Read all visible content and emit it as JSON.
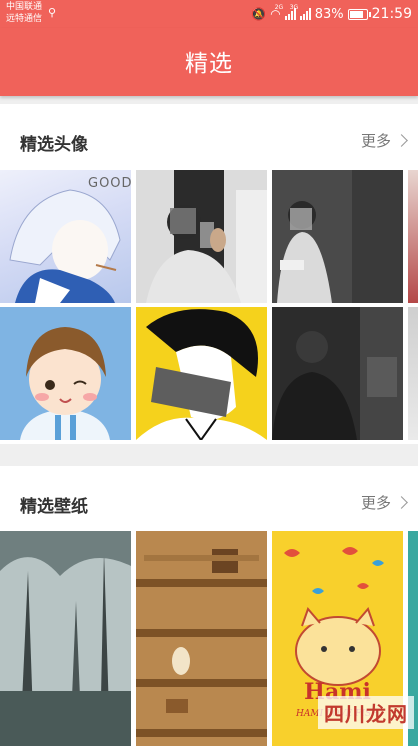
{
  "status": {
    "carrier_line1": "中国联通",
    "carrier_line2": "远特通信",
    "battery": "83%",
    "time": "21:59",
    "net1": "2G",
    "net2": "3G"
  },
  "appbar": {
    "title": "精选"
  },
  "sections": [
    {
      "title": "精选头像",
      "more": "更多",
      "tiles": [
        {
          "name": "anime-boy-avatar",
          "text": "GOOD"
        },
        {
          "name": "mirror-selfie-avatar"
        },
        {
          "name": "dark-room-avatar"
        },
        {
          "name": "cartoon-boy-avatar"
        },
        {
          "name": "anime-yellow-avatar"
        },
        {
          "name": "night-person-avatar"
        }
      ]
    },
    {
      "title": "精选壁纸",
      "more": "更多",
      "tiles": [
        {
          "name": "forest-wallpaper"
        },
        {
          "name": "shelf-wallpaper"
        },
        {
          "name": "hami-cat-wallpaper",
          "text": "Hami",
          "subtext": "HAMI LOVE FISH"
        }
      ]
    }
  ],
  "watermark": "四川龙网"
}
